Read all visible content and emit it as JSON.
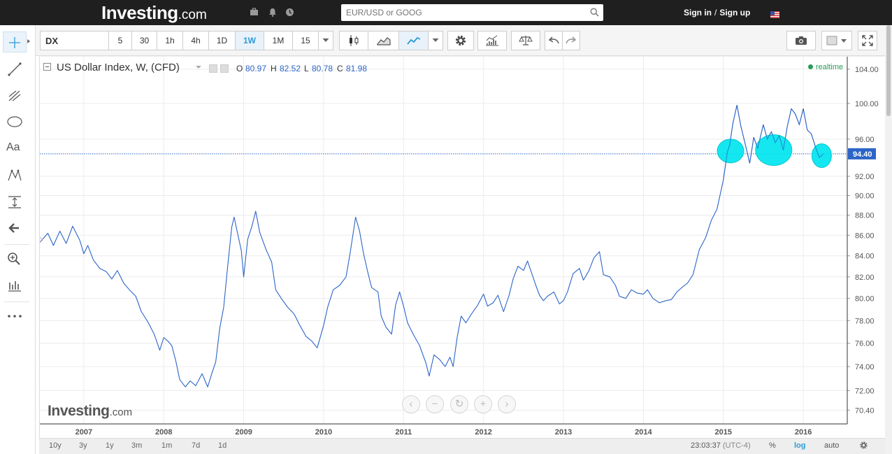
{
  "topbar": {
    "logo_main": "Investing",
    "logo_suffix": ".com",
    "search_placeholder": "EUR/USD or GOOG",
    "sign_in": "Sign in",
    "separator": "/",
    "sign_up": "Sign up"
  },
  "toolbar": {
    "symbol": "DX",
    "intervals": [
      "5",
      "30",
      "1h",
      "4h",
      "1D",
      "1W",
      "1M",
      "15"
    ],
    "active_interval": "1W"
  },
  "legend": {
    "title": "US Dollar Index, W, (CFD)",
    "o_label": "O",
    "o_value": "80.97",
    "h_label": "H",
    "h_value": "82.52",
    "l_label": "L",
    "l_value": "80.78",
    "c_label": "C",
    "c_value": "81.98",
    "realtime": "realtime"
  },
  "watermark": {
    "main": "Investing",
    "suffix": ".com"
  },
  "bottombar": {
    "ranges": [
      "10y",
      "3y",
      "1y",
      "3m",
      "1m",
      "7d",
      "1d"
    ],
    "time": "23:03:37",
    "timezone": "(UTC-4)",
    "opt_percent": "%",
    "opt_log": "log",
    "opt_auto": "auto"
  },
  "colors": {
    "line": "#2c65c8",
    "price_tag": "#2c65c8",
    "highlight": "#00e5ee",
    "accent": "#2b9bd6"
  },
  "icons": {
    "left_tools": [
      "crosshair-icon",
      "trend-line-icon",
      "pitchfork-icon",
      "ellipse-icon",
      "text-icon",
      "pattern-icon",
      "measure-icon",
      "back-arrow-icon",
      "zoom-in-icon",
      "indicator-icon",
      "more-icon"
    ],
    "chart_tools": [
      "candles-icon",
      "area-icon",
      "line-icon",
      "chevron-down-icon",
      "gear-icon",
      "indicators-icon",
      "compare-icon",
      "undo-icon",
      "redo-icon",
      "camera-icon",
      "color-icon",
      "fullscreen-icon"
    ]
  },
  "chart_data": {
    "type": "line",
    "title": "US Dollar Index, W, (CFD)",
    "xlabel": "",
    "ylabel": "",
    "scale": "log",
    "x_ticks": [
      "2007",
      "2008",
      "2009",
      "2010",
      "2011",
      "2012",
      "2013",
      "2014",
      "2015",
      "2016"
    ],
    "y_ticks": [
      104.0,
      100.0,
      96.0,
      94.4,
      92.0,
      90.0,
      88.0,
      86.0,
      84.0,
      82.0,
      80.0,
      78.0,
      76.0,
      74.0,
      72.0,
      70.4
    ],
    "y_range": [
      69.3,
      105.5
    ],
    "last_price": 94.4,
    "grid": true,
    "series": [
      {
        "values": [
          [
            2006.45,
            85.3
          ],
          [
            2006.55,
            86.2
          ],
          [
            2006.62,
            85.0
          ],
          [
            2006.7,
            86.4
          ],
          [
            2006.78,
            85.2
          ],
          [
            2006.86,
            86.9
          ],
          [
            2006.95,
            85.5
          ],
          [
            2007.0,
            84.2
          ],
          [
            2007.05,
            85.0
          ],
          [
            2007.12,
            83.6
          ],
          [
            2007.2,
            82.8
          ],
          [
            2007.28,
            82.5
          ],
          [
            2007.35,
            81.8
          ],
          [
            2007.42,
            82.6
          ],
          [
            2007.5,
            81.4
          ],
          [
            2007.57,
            80.8
          ],
          [
            2007.65,
            80.2
          ],
          [
            2007.72,
            78.8
          ],
          [
            2007.8,
            77.9
          ],
          [
            2007.88,
            76.8
          ],
          [
            2007.95,
            75.4
          ],
          [
            2008.0,
            76.5
          ],
          [
            2008.05,
            76.2
          ],
          [
            2008.1,
            75.8
          ],
          [
            2008.15,
            74.5
          ],
          [
            2008.2,
            72.9
          ],
          [
            2008.27,
            72.3
          ],
          [
            2008.33,
            72.8
          ],
          [
            2008.4,
            72.4
          ],
          [
            2008.48,
            73.4
          ],
          [
            2008.55,
            72.3
          ],
          [
            2008.6,
            73.4
          ],
          [
            2008.65,
            74.4
          ],
          [
            2008.7,
            77.3
          ],
          [
            2008.75,
            79.2
          ],
          [
            2008.8,
            83.0
          ],
          [
            2008.85,
            86.8
          ],
          [
            2008.88,
            87.8
          ],
          [
            2008.92,
            86.3
          ],
          [
            2008.97,
            84.5
          ],
          [
            2009.0,
            82.0
          ],
          [
            2009.05,
            85.6
          ],
          [
            2009.1,
            86.8
          ],
          [
            2009.15,
            88.4
          ],
          [
            2009.2,
            86.3
          ],
          [
            2009.28,
            84.6
          ],
          [
            2009.35,
            83.4
          ],
          [
            2009.4,
            80.8
          ],
          [
            2009.47,
            80.0
          ],
          [
            2009.55,
            79.2
          ],
          [
            2009.63,
            78.6
          ],
          [
            2009.7,
            77.6
          ],
          [
            2009.78,
            76.6
          ],
          [
            2009.85,
            76.2
          ],
          [
            2009.92,
            75.6
          ],
          [
            2010.0,
            77.6
          ],
          [
            2010.05,
            79.2
          ],
          [
            2010.12,
            80.8
          ],
          [
            2010.2,
            81.2
          ],
          [
            2010.28,
            82.0
          ],
          [
            2010.33,
            84.2
          ],
          [
            2010.4,
            87.8
          ],
          [
            2010.45,
            86.4
          ],
          [
            2010.5,
            84.2
          ],
          [
            2010.55,
            82.5
          ],
          [
            2010.6,
            81.0
          ],
          [
            2010.68,
            80.6
          ],
          [
            2010.72,
            78.4
          ],
          [
            2010.78,
            77.4
          ],
          [
            2010.85,
            76.8
          ],
          [
            2010.9,
            79.4
          ],
          [
            2010.95,
            80.6
          ],
          [
            2011.0,
            79.3
          ],
          [
            2011.05,
            77.8
          ],
          [
            2011.12,
            76.8
          ],
          [
            2011.2,
            75.8
          ],
          [
            2011.28,
            74.3
          ],
          [
            2011.32,
            73.2
          ],
          [
            2011.38,
            75.0
          ],
          [
            2011.45,
            74.6
          ],
          [
            2011.52,
            74.0
          ],
          [
            2011.58,
            74.8
          ],
          [
            2011.62,
            74.0
          ],
          [
            2011.67,
            76.5
          ],
          [
            2011.72,
            78.4
          ],
          [
            2011.78,
            77.8
          ],
          [
            2011.85,
            78.6
          ],
          [
            2011.92,
            79.3
          ],
          [
            2012.0,
            80.4
          ],
          [
            2012.05,
            79.3
          ],
          [
            2012.12,
            79.6
          ],
          [
            2012.18,
            80.3
          ],
          [
            2012.25,
            78.8
          ],
          [
            2012.32,
            80.3
          ],
          [
            2012.37,
            81.8
          ],
          [
            2012.43,
            83.0
          ],
          [
            2012.5,
            82.6
          ],
          [
            2012.55,
            83.5
          ],
          [
            2012.6,
            82.4
          ],
          [
            2012.65,
            81.3
          ],
          [
            2012.7,
            80.3
          ],
          [
            2012.75,
            79.8
          ],
          [
            2012.8,
            80.2
          ],
          [
            2012.88,
            80.6
          ],
          [
            2012.95,
            79.5
          ],
          [
            2013.0,
            79.8
          ],
          [
            2013.05,
            80.6
          ],
          [
            2013.12,
            82.3
          ],
          [
            2013.2,
            82.8
          ],
          [
            2013.25,
            81.7
          ],
          [
            2013.32,
            82.6
          ],
          [
            2013.38,
            83.8
          ],
          [
            2013.45,
            84.4
          ],
          [
            2013.5,
            82.2
          ],
          [
            2013.58,
            82.0
          ],
          [
            2013.65,
            81.2
          ],
          [
            2013.7,
            80.2
          ],
          [
            2013.78,
            80.0
          ],
          [
            2013.85,
            80.8
          ],
          [
            2013.92,
            80.5
          ],
          [
            2014.0,
            80.4
          ],
          [
            2014.05,
            80.8
          ],
          [
            2014.12,
            80.0
          ],
          [
            2014.2,
            79.6
          ],
          [
            2014.28,
            79.8
          ],
          [
            2014.35,
            79.9
          ],
          [
            2014.42,
            80.6
          ],
          [
            2014.48,
            81.0
          ],
          [
            2014.55,
            81.4
          ],
          [
            2014.62,
            82.2
          ],
          [
            2014.7,
            84.6
          ],
          [
            2014.78,
            85.8
          ],
          [
            2014.85,
            87.5
          ],
          [
            2014.92,
            88.6
          ],
          [
            2015.0,
            91.6
          ],
          [
            2015.05,
            94.6
          ],
          [
            2015.08,
            95.4
          ],
          [
            2015.12,
            97.8
          ],
          [
            2015.17,
            99.8
          ],
          [
            2015.22,
            97.4
          ],
          [
            2015.27,
            95.6
          ],
          [
            2015.33,
            93.4
          ],
          [
            2015.38,
            96.2
          ],
          [
            2015.43,
            95.0
          ],
          [
            2015.5,
            97.6
          ],
          [
            2015.55,
            96.0
          ],
          [
            2015.6,
            96.8
          ],
          [
            2015.65,
            95.6
          ],
          [
            2015.7,
            96.4
          ],
          [
            2015.75,
            94.8
          ],
          [
            2015.8,
            97.4
          ],
          [
            2015.85,
            99.4
          ],
          [
            2015.9,
            98.8
          ],
          [
            2015.95,
            97.6
          ],
          [
            2016.0,
            99.4
          ],
          [
            2016.05,
            97.0
          ],
          [
            2016.1,
            96.6
          ],
          [
            2016.15,
            95.2
          ],
          [
            2016.2,
            94.0
          ],
          [
            2016.25,
            94.4
          ]
        ]
      }
    ],
    "annotations": [
      {
        "shape": "ellipse",
        "center": [
          2015.09,
          94.7
        ],
        "color": "#00e5ee"
      },
      {
        "shape": "ellipse",
        "center": [
          2015.63,
          94.8
        ],
        "color": "#00e5ee"
      },
      {
        "shape": "ellipse",
        "center": [
          2016.23,
          94.2
        ],
        "color": "#00e5ee"
      }
    ]
  }
}
